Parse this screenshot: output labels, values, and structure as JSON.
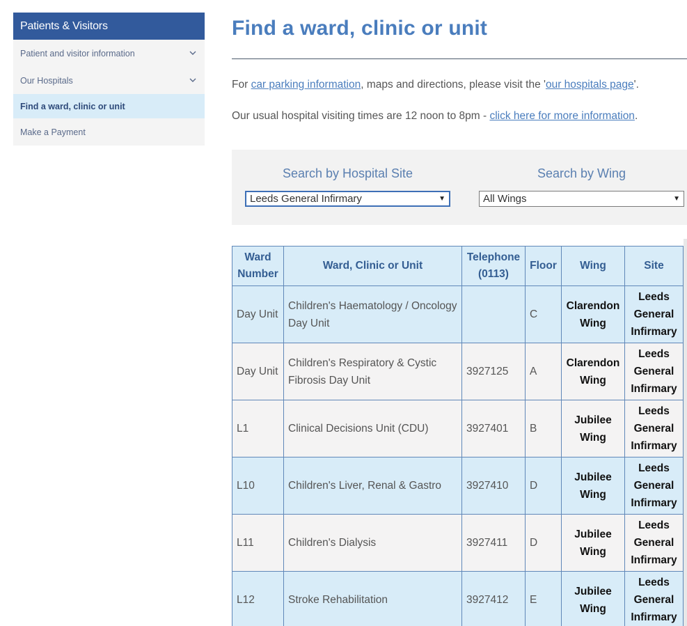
{
  "sidebar": {
    "title": "Patients & Visitors",
    "items": [
      {
        "label": "Patient and visitor information",
        "has_chevron": true
      },
      {
        "label": "Our Hospitals",
        "has_chevron": true
      },
      {
        "label": "Find a ward, clinic or unit",
        "active": true
      },
      {
        "label": "Make a Payment"
      }
    ]
  },
  "main": {
    "title": "Find a ward, clinic or unit",
    "para1": {
      "before": "For ",
      "link1": "car parking information",
      "middle": ", maps and directions, please visit the '",
      "link2": "our hospitals page",
      "after": "'."
    },
    "para2": {
      "before": "Our usual hospital visiting times are 12 noon to 8pm - ",
      "link": "click here for more information",
      "after": "."
    }
  },
  "search": {
    "site_label": "Search by Hospital Site",
    "site_value": "Leeds General Infirmary",
    "wing_label": "Search by Wing",
    "wing_value": "All Wings"
  },
  "table": {
    "headers": {
      "ward_number": "Ward Number",
      "ward_name": "Ward, Clinic or Unit",
      "telephone": "Telephone (0113)",
      "floor": "Floor",
      "wing": "Wing",
      "site": "Site"
    },
    "rows": [
      {
        "number": "Day Unit",
        "name": "Children's Haematology / Oncology Day Unit",
        "phone": "",
        "floor": "C",
        "wing": "Clarendon Wing",
        "site": "Leeds General Infirmary"
      },
      {
        "number": "Day Unit",
        "name": "Children's Respiratory & Cystic Fibrosis Day Unit",
        "phone": "3927125",
        "floor": "A",
        "wing": "Clarendon Wing",
        "site": "Leeds General Infirmary"
      },
      {
        "number": "L1",
        "name": "Clinical Decisions Unit (CDU)",
        "phone": "3927401",
        "floor": "B",
        "wing": "Jubilee Wing",
        "site": "Leeds General Infirmary"
      },
      {
        "number": "L10",
        "name": "Children's Liver, Renal & Gastro",
        "phone": "3927410",
        "floor": "D",
        "wing": "Jubilee Wing",
        "site": "Leeds General Infirmary"
      },
      {
        "number": "L11",
        "name": "Children's Dialysis",
        "phone": "3927411",
        "floor": "D",
        "wing": "Jubilee Wing",
        "site": "Leeds General Infirmary"
      },
      {
        "number": "L12",
        "name": "Stroke Rehabilitation",
        "phone": "3927412",
        "floor": "E",
        "wing": "Jubilee Wing",
        "site": "Leeds General Infirmary"
      }
    ]
  },
  "colors": {
    "brand_blue": "#325a9c",
    "title_blue": "#4a7dbd",
    "row_blue": "#d8ecf8",
    "row_grey": "#f4f3f3"
  }
}
